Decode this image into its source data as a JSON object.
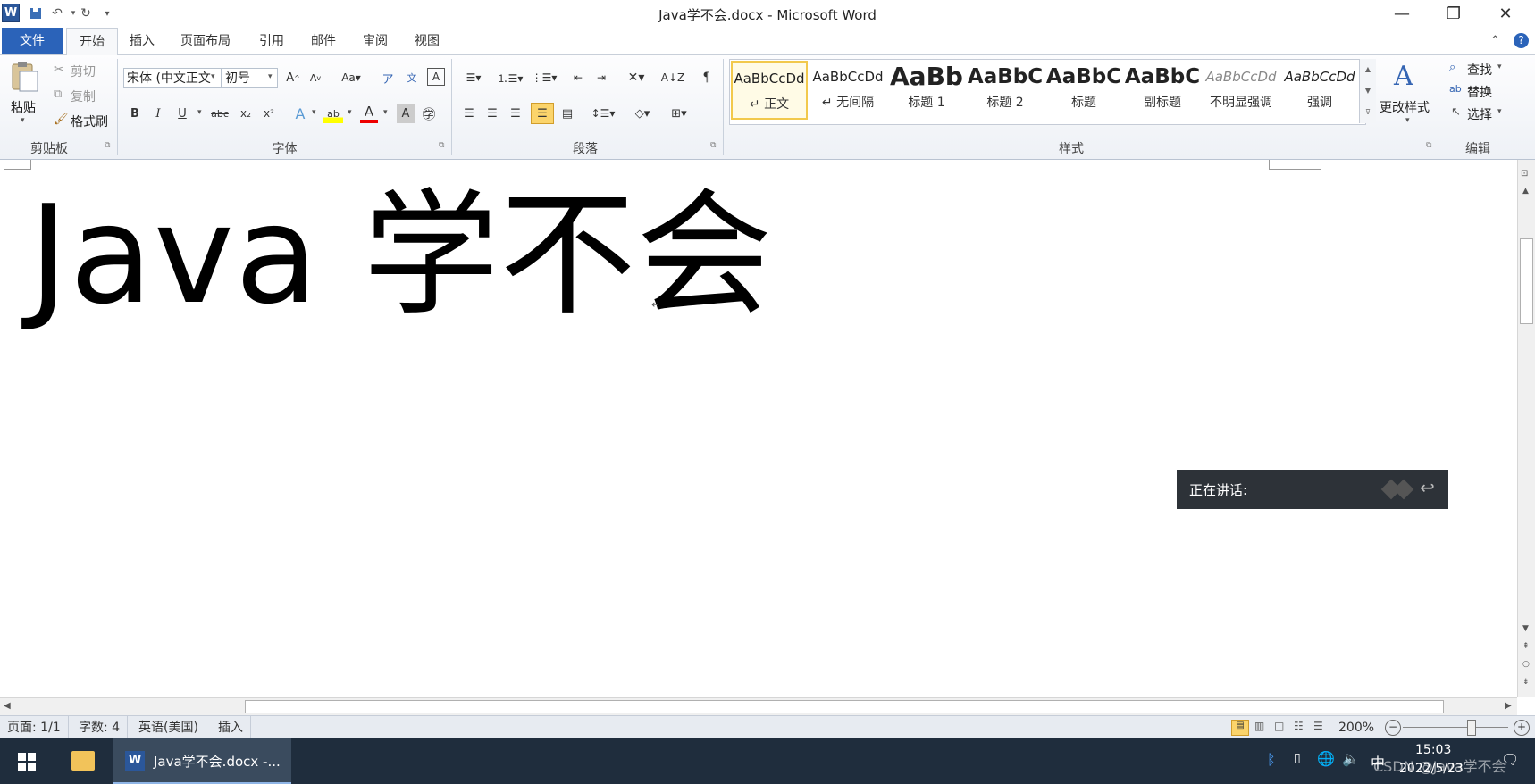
{
  "window": {
    "title": "Java学不会.docx - Microsoft Word",
    "app_icon_letter": "W"
  },
  "tabs": [
    "文件",
    "开始",
    "插入",
    "页面布局",
    "引用",
    "邮件",
    "审阅",
    "视图"
  ],
  "ribbon": {
    "clipboard": {
      "paste": "粘贴",
      "cut": "剪切",
      "copy": "复制",
      "format_painter": "格式刷",
      "label": "剪贴板"
    },
    "font": {
      "font_name": "宋体 (中文正文",
      "font_size": "初号",
      "label": "字体"
    },
    "paragraph": {
      "label": "段落"
    },
    "styles": {
      "label": "样式",
      "items": [
        {
          "sample": "AaBbCcDd",
          "name": "↵ 正文"
        },
        {
          "sample": "AaBbCcDd",
          "name": "↵ 无间隔"
        },
        {
          "sample": "AaBb",
          "name": "标题 1"
        },
        {
          "sample": "AaBbC",
          "name": "标题 2"
        },
        {
          "sample": "AaBbC",
          "name": "标题"
        },
        {
          "sample": "AaBbC",
          "name": "副标题"
        },
        {
          "sample": "AaBbCcDd",
          "name": "不明显强调"
        },
        {
          "sample": "AaBbCcDd",
          "name": "强调"
        }
      ],
      "change_styles": "更改样式"
    },
    "editing": {
      "find": "查找",
      "replace": "替换",
      "select": "选择",
      "label": "编辑"
    }
  },
  "document": {
    "heading_latin": "Java ",
    "heading_cjk": "学不会",
    "paragraph_mark": "↵"
  },
  "speech_overlay": {
    "label": "正在讲话:"
  },
  "status": {
    "page": "页面: 1/1",
    "word_count": "字数: 4",
    "language": "英语(美国)",
    "mode": "插入",
    "zoom": "200%"
  },
  "taskbar": {
    "app_label": "Java学不会.docx -...",
    "ime": "中",
    "time": "15:03",
    "date": "2022/5/23",
    "watermark": "CSDN @Java学不会"
  },
  "colors": {
    "file_tab": "#2b63b9",
    "taskbar": "#1f2d3d",
    "speech_bg": "#2d3238"
  }
}
